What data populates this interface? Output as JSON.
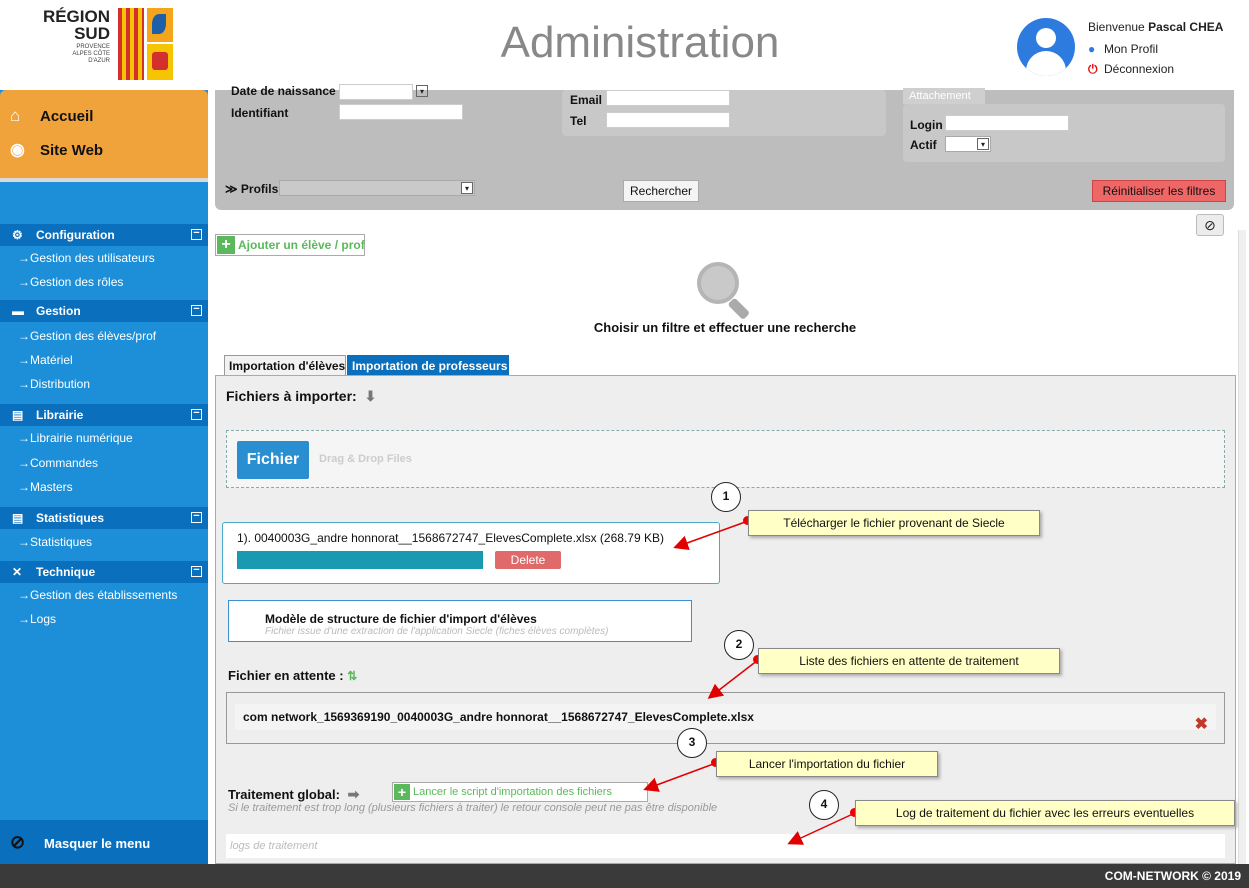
{
  "header": {
    "region_logo_text": "RÉGION\nSUD",
    "region_logo_sub": "PROVENCE ALPES CÔTE D'AZUR",
    "title": "Administration",
    "welcome_prefix": "Bienvenue",
    "user_name": "Pascal CHEA",
    "profile_link": "Mon Profil",
    "logout_link": "Déconnexion"
  },
  "sidebar": {
    "top": [
      {
        "label": "Accueil",
        "icon": "home-icon"
      },
      {
        "label": "Site Web",
        "icon": "map-pin-icon"
      }
    ],
    "sections": [
      {
        "label": "Configuration",
        "icon": "gears-icon",
        "items": [
          "Gestion des utilisateurs",
          "Gestion des rôles"
        ]
      },
      {
        "label": "Gestion",
        "icon": "folder-icon",
        "items": [
          "Gestion des élèves/prof",
          "Matériel",
          "Distribution"
        ]
      },
      {
        "label": "Librairie",
        "icon": "library-icon",
        "items": [
          "Librairie numérique",
          "Commandes",
          "Masters"
        ]
      },
      {
        "label": "Statistiques",
        "icon": "chart-icon",
        "items": [
          "Statistiques"
        ]
      },
      {
        "label": "Technique",
        "icon": "tools-icon",
        "items": [
          "Gestion des établissements",
          "Logs"
        ]
      }
    ],
    "hide_menu": "Masquer le menu"
  },
  "filters": {
    "birthdate_label": "Date de naissance",
    "identifiant_label": "Identifiant",
    "email_label": "Email",
    "tel_label": "Tel",
    "attachement_label": "Attachement",
    "login_label": "Login",
    "actif_label": "Actif",
    "profils_label": "Profils",
    "search_button": "Rechercher",
    "reset_button": "Réinitialiser les filtres"
  },
  "main": {
    "add_button": "Ajouter un élève / prof",
    "empty_message": "Choisir un filtre et effectuer une recherche",
    "tabs": [
      "Importation d'élèves",
      "Importation de professeurs"
    ]
  },
  "import": {
    "files_title": "Fichiers à importer:",
    "file_button": "Fichier",
    "drag_drop_hint": "Drag & Drop Files",
    "uploaded_file": "1). 0040003G_andre honnorat__1568672747_ElevesComplete.xlsx (268.79 KB)",
    "upload_progress": 1.0,
    "delete_button": "Delete",
    "model_title": "Modèle de structure de fichier d'import d'élèves",
    "model_subtitle": "Fichier issue d'une extraction de l'application Siecle (fiches élèves complètes)",
    "pending_title": "Fichier en attente :",
    "pending_file": "com network_1569369190_0040003G_andre honnorat__1568672747_ElevesComplete.xlsx",
    "global_title": "Traitement global:",
    "launch_button": "Lancer le script d'importation des fichiers",
    "warning": "Si le traitement est trop long (plusieurs fichiers à traiter) le retour console peut ne pas être disponible",
    "logs_placeholder": "logs de traitement"
  },
  "annotations": [
    {
      "number": "1",
      "text": "Télécharger le fichier provenant de Siecle"
    },
    {
      "number": "2",
      "text": "Liste des fichiers en attente de traitement"
    },
    {
      "number": "3",
      "text": "Lancer l'importation du fichier"
    },
    {
      "number": "4",
      "text": "Log de traitement du fichier avec les erreurs eventuelles"
    }
  ],
  "footer": {
    "copyright": "COM-NETWORK © 2019"
  },
  "colors": {
    "accent_blue": "#0a6fbd",
    "sidebar_blue": "#1d8fd8",
    "orange": "#f0a23b",
    "note_yellow": "#ffffc6",
    "arrow_red": "#e00000"
  }
}
